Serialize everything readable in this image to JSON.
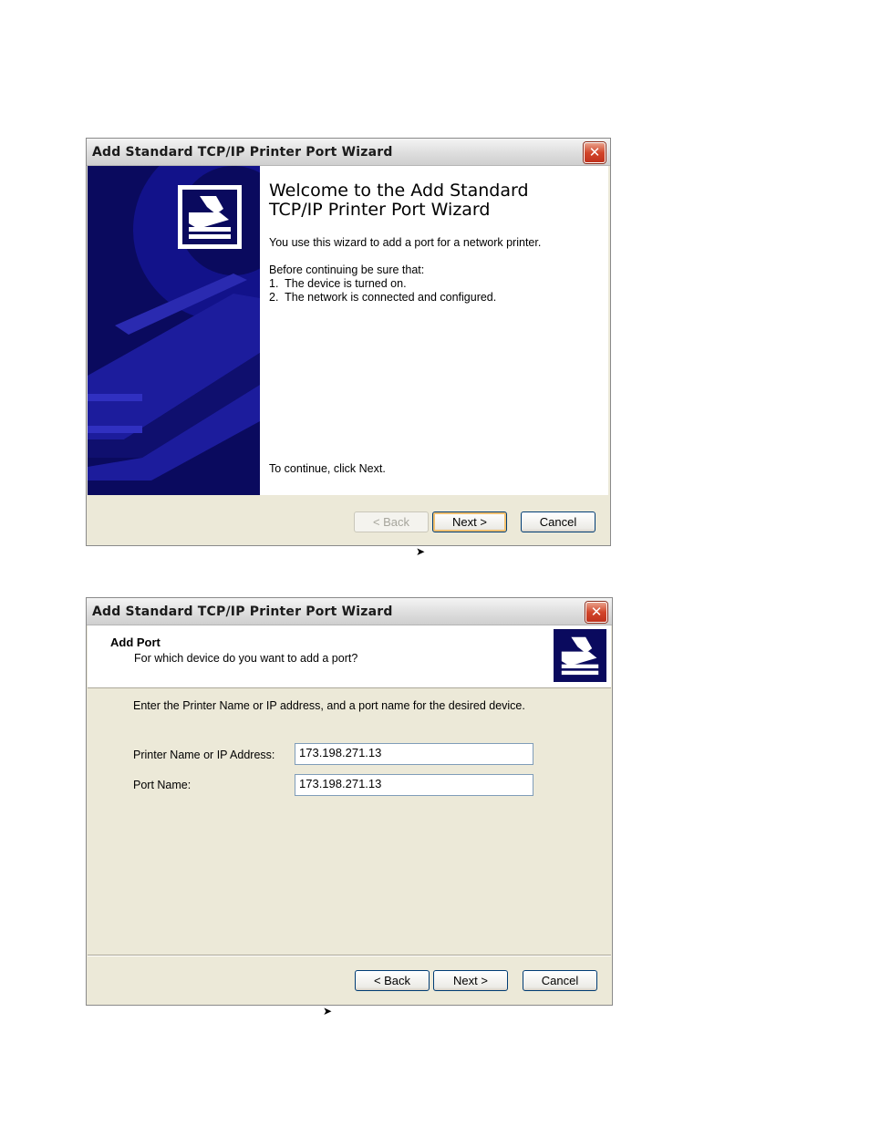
{
  "dialog1": {
    "title": "Add Standard TCP/IP Printer Port Wizard",
    "close_glyph": "✕",
    "heading_line1": "Welcome to the Add Standard",
    "heading_line2": "TCP/IP Printer Port Wizard",
    "intro": "You use this wizard to add a port for a network printer.",
    "before": "Before continuing be sure that:",
    "item1": "1.  The device is turned on.",
    "item2": "2.  The network is connected and configured.",
    "continue_text": "To continue, click Next.",
    "back_label": "< Back",
    "next_label": "Next >",
    "cancel_label": "Cancel",
    "icon": "printer-icon"
  },
  "arrow1": "➤",
  "dialog2": {
    "title": "Add Standard TCP/IP Printer Port Wizard",
    "close_glyph": "✕",
    "header_title": "Add Port",
    "header_subtitle": "For which device do you want to add a port?",
    "instruction": "Enter the Printer Name or IP address, and a port name for the desired device.",
    "printer_label": "Printer Name or IP Address:",
    "printer_value": "173.198.271.13",
    "port_label": "Port Name:",
    "port_value": "173.198.271.13",
    "back_label": "< Back",
    "next_label": "Next >",
    "cancel_label": "Cancel",
    "icon": "printer-icon"
  },
  "arrow2": "➤",
  "colors": {
    "banner_navy": "#0a0a5e",
    "banner_blue": "#1c1c9c",
    "dialog_face": "#ece9d8"
  }
}
